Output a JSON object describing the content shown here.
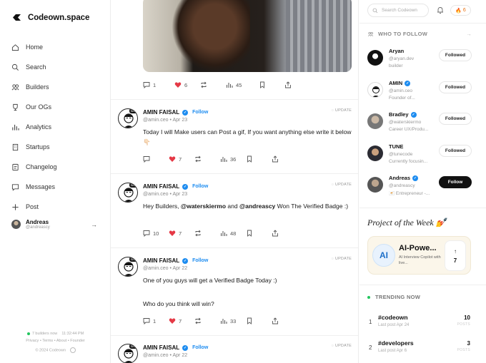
{
  "app": {
    "name": "Codeown.space"
  },
  "sidebar": {
    "items": [
      {
        "label": "Home",
        "icon": "home-icon"
      },
      {
        "label": "Search",
        "icon": "search-icon"
      },
      {
        "label": "Builders",
        "icon": "users-icon"
      },
      {
        "label": "Our OGs",
        "icon": "trophy-icon"
      },
      {
        "label": "Analytics",
        "icon": "chart-icon"
      },
      {
        "label": "Startups",
        "icon": "building-icon"
      },
      {
        "label": "Changelog",
        "icon": "changelog-icon"
      },
      {
        "label": "Messages",
        "icon": "message-icon"
      },
      {
        "label": "Post",
        "icon": "plus-icon"
      }
    ],
    "user": {
      "name": "Andreas",
      "handle": "@andreascy"
    },
    "footer": {
      "builders_now": "7 builders now",
      "time": "11:32:44 PM",
      "links": [
        "Privacy",
        "Terms",
        "About",
        "Founder"
      ],
      "copyright": "© 2024 Codeown"
    }
  },
  "feed": {
    "top_post_actions": {
      "comments": "1",
      "likes": "6",
      "views": "45"
    },
    "posts": [
      {
        "name": "AMIN FAISAL",
        "follow": "Follow",
        "badge": "UPDATE",
        "handle": "@amin.ceo",
        "date": "Apr 23",
        "text": "Today I will Make users can Post a gif, If you want anything else write it below 👇🏻",
        "comments": "",
        "likes": "7",
        "views": "36"
      },
      {
        "name": "AMIN FAISAL",
        "follow": "Follow",
        "badge": "UPDATE",
        "handle": "@amin.ceo",
        "date": "Apr 23",
        "text_pre": "Hey Builders, ",
        "mention1": "@waterskiermo",
        "text_mid": " and ",
        "mention2": "@andreascy",
        "text_post": " Won The Verified Badge :)",
        "comments": "10",
        "likes": "7",
        "views": "48"
      },
      {
        "name": "AMIN FAISAL",
        "follow": "Follow",
        "badge": "UPDATE",
        "handle": "@amin.ceo",
        "date": "Apr 22",
        "line1": "One of you guys will get a Verified Badge Today :)",
        "line2": "Who do you think will win?",
        "comments": "1",
        "likes": "7",
        "views": "33"
      },
      {
        "name": "AMIN FAISAL",
        "follow": "Follow",
        "badge": "UPDATE",
        "handle": "@amin.ceo",
        "date": "Apr 22"
      }
    ]
  },
  "right": {
    "search_placeholder": "Search Codeown",
    "streak": "6",
    "who_to_follow_title": "WHO TO FOLLOW",
    "suggestions": [
      {
        "name": "Aryan",
        "handle": "@aryan.dev",
        "bio": "builder",
        "button": "Followed",
        "verified": false
      },
      {
        "name": "AMIN",
        "handle": "@amin.ceo",
        "bio": "Founder of...",
        "button": "Followed",
        "verified": true
      },
      {
        "name": "Bradley",
        "handle": "@waterskiermo",
        "bio": "Career UX/Produ...",
        "button": "Followed",
        "verified": true
      },
      {
        "name": "TUNE",
        "handle": "@tunecode",
        "bio": "Currently focusin...",
        "button": "Followed",
        "verified": false
      },
      {
        "name": "Andreas",
        "handle": "@andreascy",
        "bio": "🇨🇾 Entrepreneur -...",
        "button": "Follow",
        "verified": true
      }
    ],
    "project_of_week": {
      "title": "Project of the Week 💅",
      "logo": "AI",
      "name": "AI-Powe...",
      "desc": "AI Interview Copilot with live...",
      "votes": "7"
    },
    "trending_title": "TRENDING NOW",
    "trending": [
      {
        "rank": "1",
        "tag": "#codeown",
        "last": "Last post Apr 24",
        "count": "10",
        "unit": "POSTS"
      },
      {
        "rank": "2",
        "tag": "#developers",
        "last": "Last post Apr 6",
        "count": "3",
        "unit": "POSTS"
      }
    ]
  },
  "colors": {
    "accent": "#1d8cf0",
    "like": "#e53946",
    "streak": "#e8700f"
  }
}
